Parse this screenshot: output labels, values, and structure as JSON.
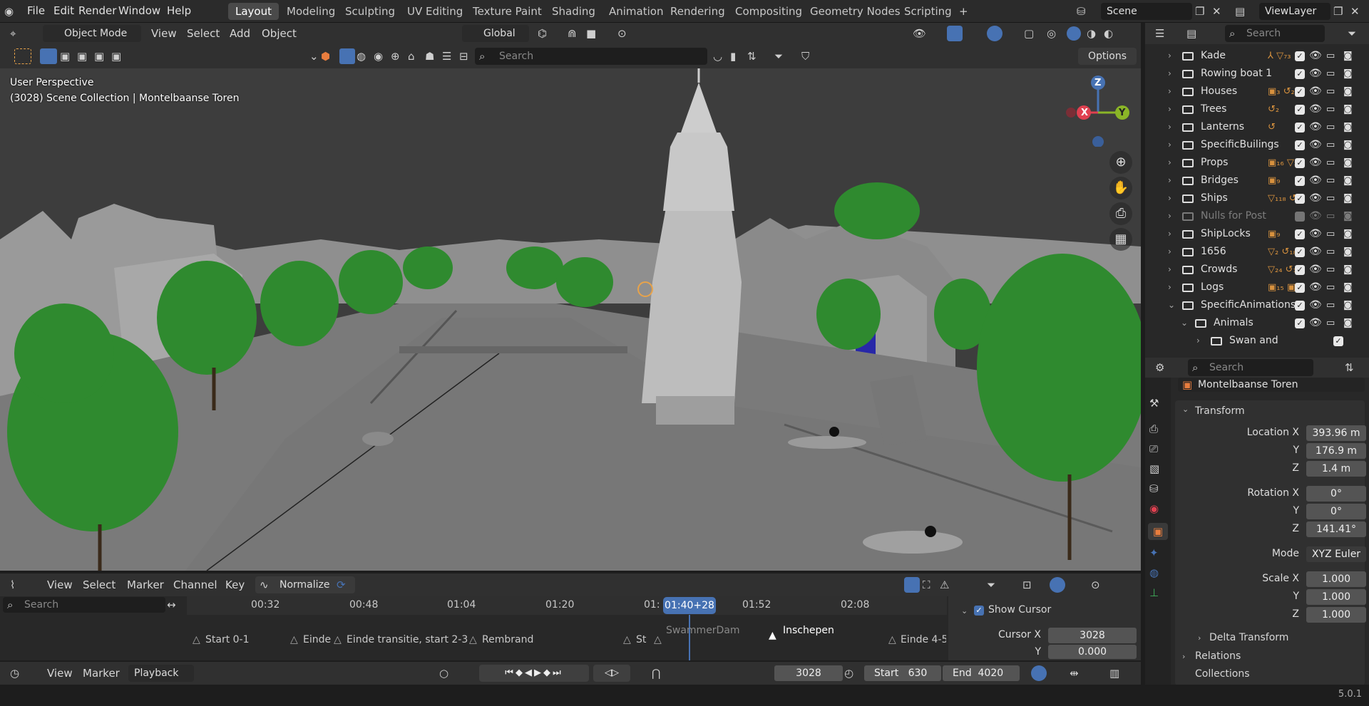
{
  "menus": [
    "File",
    "Edit",
    "Render",
    "Window",
    "Help"
  ],
  "workspaces": [
    "Layout",
    "Modeling",
    "Sculpting",
    "UV Editing",
    "Texture Paint",
    "Shading",
    "Animation",
    "Rendering",
    "Compositing",
    "Geometry Nodes",
    "Scripting"
  ],
  "active_workspace": "Layout",
  "scene": "Scene",
  "view_layer": "ViewLayer",
  "viewport": {
    "mode": "Object Mode",
    "menu": [
      "View",
      "Select",
      "Add",
      "Object"
    ],
    "orientation": "Global",
    "search_placeholder": "Search",
    "options_label": "Options",
    "perspective": "User Perspective",
    "collection_info": "(3028) Scene Collection | Montelbaanse Toren",
    "axis_labels": {
      "z": "Z",
      "x": "X",
      "y": "Y"
    }
  },
  "outliner": {
    "search_placeholder": "Search",
    "rows": [
      {
        "label": "Kade",
        "badges": "⅄ ▽₇₃",
        "enabled": true
      },
      {
        "label": "Rowing boat 1",
        "badges": "",
        "enabled": true
      },
      {
        "label": "Houses",
        "badges": "▣₃ ↺₂₂",
        "enabled": true
      },
      {
        "label": "Trees",
        "badges": "↺₂",
        "enabled": true
      },
      {
        "label": "Lanterns",
        "badges": "↺",
        "enabled": true
      },
      {
        "label": "SpecificBuilings",
        "badges": "",
        "enabled": true
      },
      {
        "label": "Props",
        "badges": "▣₁₆ ▽₂",
        "enabled": true
      },
      {
        "label": "Bridges",
        "badges": "▣₉",
        "enabled": true
      },
      {
        "label": "Ships",
        "badges": "▽₁₁₈ ↺₃₁",
        "enabled": true
      },
      {
        "label": "Nulls for Post",
        "badges": "",
        "enabled": false
      },
      {
        "label": "ShipLocks",
        "badges": "▣₉",
        "enabled": true
      },
      {
        "label": "1656",
        "badges": "▽₂ ↺₁₈",
        "enabled": true
      },
      {
        "label": "Crowds",
        "badges": "▽₂₄ ↺₁",
        "enabled": true
      },
      {
        "label": "Logs",
        "badges": "▣₁₅ ▣₃",
        "enabled": true
      },
      {
        "label": "SpecificAnimations",
        "badges": "",
        "enabled": true
      },
      {
        "label": "Animals",
        "badges": "",
        "enabled": true
      },
      {
        "label": "Swan and",
        "badges": "",
        "enabled": true
      }
    ]
  },
  "properties": {
    "search_placeholder": "Search",
    "object_name": "Montelbaanse Toren",
    "transform_title": "Transform",
    "location": {
      "label": "Location X",
      "x": "393.96 m",
      "y": "176.9 m",
      "z": "1.4 m"
    },
    "rotation": {
      "label": "Rotation X",
      "x": "0°",
      "y": "0°",
      "z": "141.41°"
    },
    "mode_label": "Mode",
    "mode_value": "XYZ Euler",
    "scale": {
      "label": "Scale X",
      "x": "1.000",
      "y": "1.000",
      "z": "1.000"
    },
    "y_label": "Y",
    "z_label": "Z",
    "delta_transform": "Delta Transform",
    "relations": "Relations",
    "collections": "Collections"
  },
  "timeline": {
    "menu": [
      "View",
      "Select",
      "Marker",
      "Channel",
      "Key"
    ],
    "normalize": "Normalize",
    "search_placeholder": "Search",
    "ticks": [
      "00:32",
      "00:48",
      "01:04",
      "01:20",
      "01:",
      "01:52",
      "02:08"
    ],
    "current_time": "01:40+28",
    "markers": [
      "Start 0-1",
      "Einde",
      "Einde transitie, start 2-3",
      "Rembrand",
      "St",
      "SwammerDam",
      "Inschepen",
      "Einde 4-5"
    ],
    "show_cursor": "Show Cursor",
    "cursor_x_label": "Cursor X",
    "cursor_x": "3028",
    "cursor_y_label": "Y",
    "cursor_y": "0.000"
  },
  "playback": {
    "menu": [
      "View",
      "Marker"
    ],
    "playback_label": "Playback",
    "current_frame": "3028",
    "start_label": "Start",
    "start": "630",
    "end_label": "End",
    "end": "4020"
  },
  "status": {
    "version": "5.0.1"
  },
  "colors": {
    "accent": "#4772b3",
    "tree": "#2f8a2f",
    "sky": "#3d3d3d"
  }
}
